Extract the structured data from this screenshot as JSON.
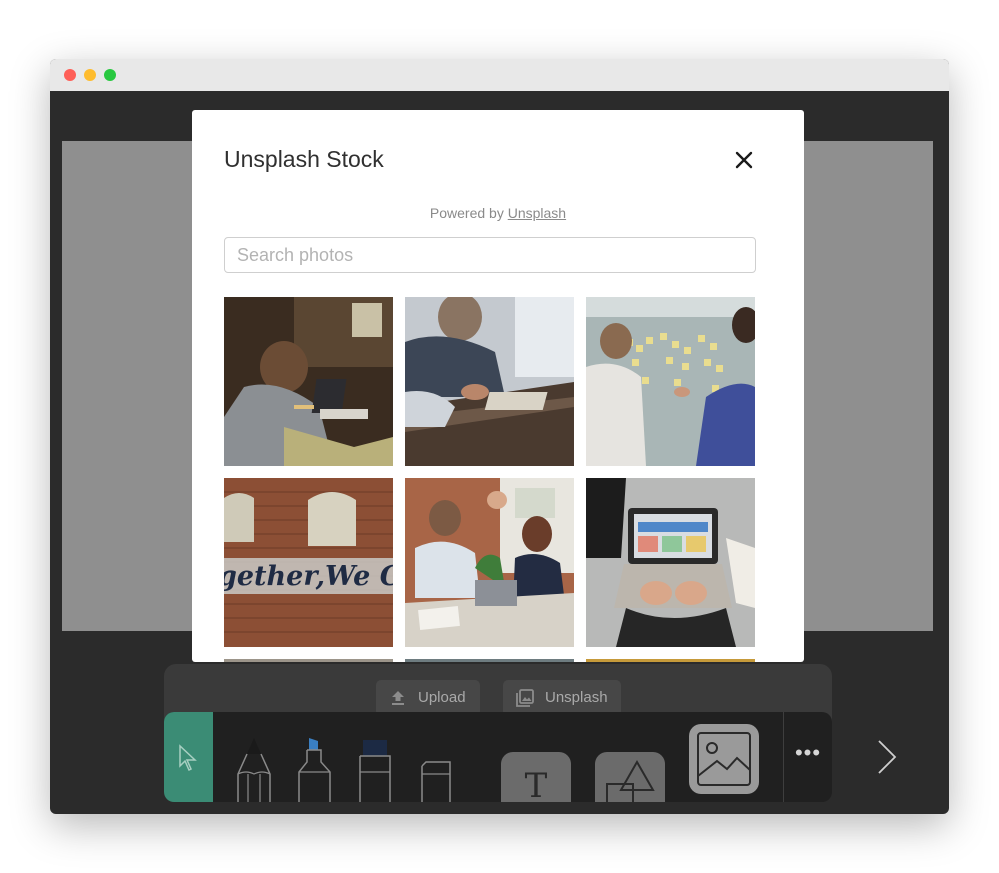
{
  "modal": {
    "title": "Unsplash Stock",
    "powered_by_text": "Powered by",
    "powered_by_link": "Unsplash",
    "search_placeholder": "Search photos",
    "photo_count_visible": 9
  },
  "photos": [
    {
      "name": "photo-video-call"
    },
    {
      "name": "photo-meeting-table"
    },
    {
      "name": "photo-sticky-notes"
    },
    {
      "name": "photo-brick-wall-graffiti",
      "caption": "gether,We Cre"
    },
    {
      "name": "photo-high-five"
    },
    {
      "name": "photo-laptop-typing"
    },
    {
      "name": "photo-partial-1"
    },
    {
      "name": "photo-partial-2"
    },
    {
      "name": "photo-partial-3"
    }
  ],
  "source_bar": {
    "upload_label": "Upload",
    "unsplash_label": "Unsplash"
  },
  "toolbar": {
    "text_tool_glyph": "T",
    "more_glyph": "•••",
    "active_color": "#3b8c75",
    "tools": [
      "select-tool",
      "pencil-tool",
      "marker-blue-tool",
      "marker-navy-tool",
      "eraser-tool",
      "text-tool",
      "shape-tool",
      "image-tool"
    ]
  },
  "colors": {
    "accent": "#3b8c75",
    "window_bg": "#2b2b2b",
    "canvas": "#8f8f8f"
  }
}
